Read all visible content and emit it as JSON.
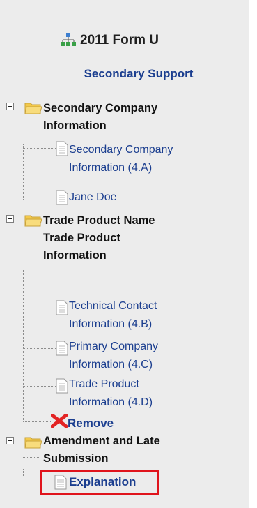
{
  "header": {
    "title": "2011 Form U",
    "icon": "sitemap-icon"
  },
  "subtitle": "Secondary Support",
  "tree": {
    "group1": {
      "label_lines": [
        "Secondary Company",
        "Information"
      ],
      "items": [
        {
          "lines": [
            "Secondary Company",
            "Information (4.A)"
          ]
        },
        {
          "lines": [
            "Jane Doe"
          ]
        }
      ]
    },
    "group2": {
      "label_lines": [
        "Trade Product Name",
        "Trade Product",
        "Information"
      ],
      "items": [
        {
          "lines": [
            "Technical Contact",
            "Information (4.B)"
          ]
        },
        {
          "lines": [
            "Primary Company",
            "Information (4.C)"
          ]
        },
        {
          "lines": [
            "Trade Product",
            "Information (4.D)"
          ]
        }
      ],
      "remove_label": "Remove"
    },
    "group3": {
      "label_lines": [
        "Amendment and Late",
        "Submission"
      ],
      "items": [
        {
          "lines": [
            "Explanation"
          ],
          "highlighted": true
        }
      ]
    }
  },
  "colors": {
    "link": "#1b3e8f",
    "highlight": "#e0141c",
    "panel": "#ececec"
  }
}
